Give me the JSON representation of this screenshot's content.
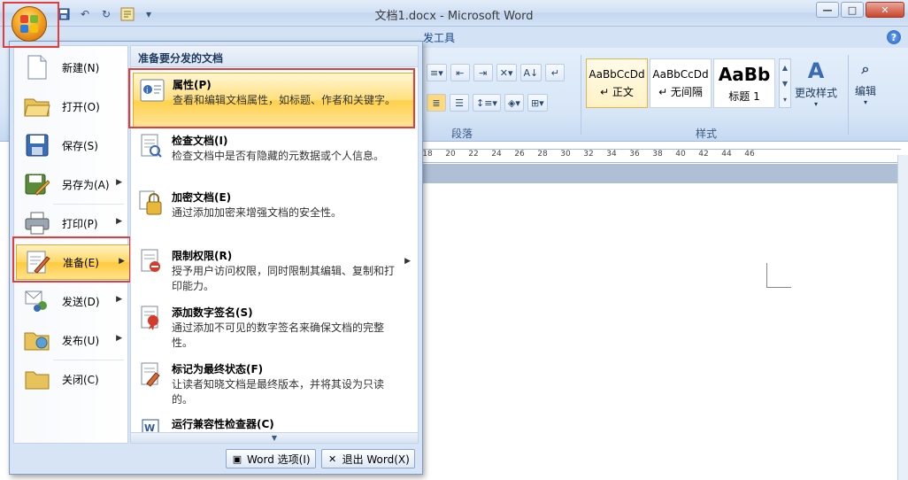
{
  "window": {
    "title": "文档1.docx - Microsoft Word",
    "minimize": "—",
    "maximize": "□",
    "close": "✕"
  },
  "ribbon": {
    "tab_partial": "发工具",
    "help": "?",
    "paragraph_group": "段落",
    "styles_group": "样式",
    "styles": [
      {
        "sample": "AaBbCcDd",
        "name": "↵ 正文"
      },
      {
        "sample": "AaBbCcDd",
        "name": "↵ 无间隔"
      },
      {
        "sample": "AaBb",
        "name": "标题 1"
      }
    ],
    "change_styles": "更改样式",
    "editing": "编辑"
  },
  "ruler": [
    "18",
    "20",
    "22",
    "24",
    "26",
    "28",
    "30",
    "32",
    "34",
    "36",
    "38",
    "40",
    "42",
    "44",
    "46"
  ],
  "office_menu": {
    "left_items": [
      {
        "label": "新建(N)",
        "arrow": ""
      },
      {
        "label": "打开(O)",
        "arrow": ""
      },
      {
        "label": "保存(S)",
        "arrow": ""
      },
      {
        "label": "另存为(A)",
        "arrow": "▶"
      },
      {
        "label": "打印(P)",
        "arrow": "▶"
      },
      {
        "label": "准备(E)",
        "arrow": "▶"
      },
      {
        "label": "发送(D)",
        "arrow": "▶"
      },
      {
        "label": "发布(U)",
        "arrow": "▶"
      },
      {
        "label": "关闭(C)",
        "arrow": ""
      }
    ],
    "submenu_header": "准备要分发的文档",
    "submenu_items": [
      {
        "title": "属性(P)",
        "desc": "查看和编辑文档属性，如标题、作者和关键字。"
      },
      {
        "title": "检查文档(I)",
        "desc": "检查文档中是否有隐藏的元数据或个人信息。"
      },
      {
        "title": "加密文档(E)",
        "desc": "通过添加加密来增强文档的安全性。"
      },
      {
        "title": "限制权限(R)",
        "desc": "授予用户访问权限，同时限制其编辑、复制和打印能力。"
      },
      {
        "title": "添加数字签名(S)",
        "desc": "通过添加不可见的数字签名来确保文档的完整性。"
      },
      {
        "title": "标记为最终状态(F)",
        "desc": "让读者知晓文档是最终版本，并将其设为只读的。"
      },
      {
        "title": "运行兼容性检查器(C)",
        "desc": ""
      }
    ],
    "word_options": "Word 选项(I)",
    "exit_word": "退出 Word(X)"
  }
}
